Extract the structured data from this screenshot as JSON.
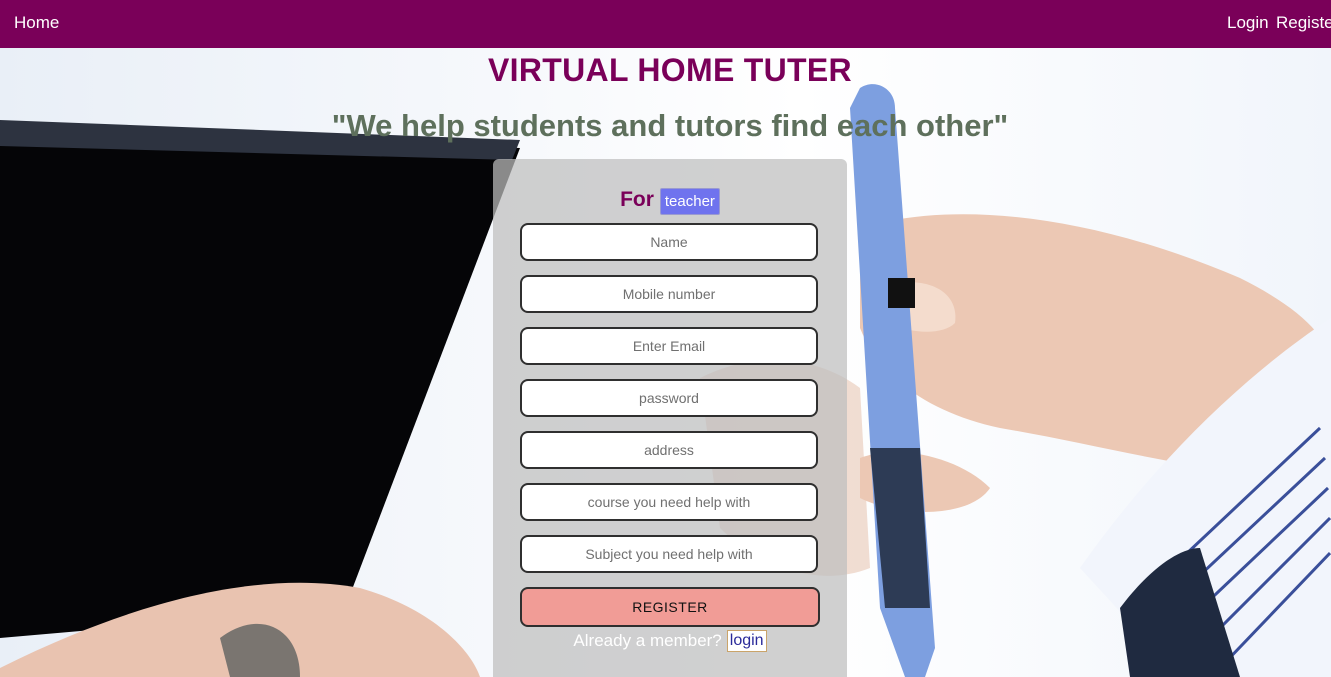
{
  "nav": {
    "home_label": "Home",
    "login_label": "Login",
    "register_label": "Register"
  },
  "header": {
    "title": "VIRTUAL HOME TUTER",
    "tagline": "\"We help students and tutors find each other\""
  },
  "form": {
    "for_label": "For",
    "role_label": "teacher",
    "fields": [
      {
        "placeholder": "Name"
      },
      {
        "placeholder": "Mobile number"
      },
      {
        "placeholder": "Enter Email"
      },
      {
        "placeholder": "password"
      },
      {
        "placeholder": "address"
      },
      {
        "placeholder": "course you need help with"
      },
      {
        "placeholder": "Subject you need help with"
      }
    ],
    "submit_label": "REGISTER",
    "member_prompt": "Already a member?",
    "login_link": "login"
  },
  "colors": {
    "nav_background": "#7a0059",
    "title_color": "#7a0059",
    "tagline_color": "#5e705c",
    "button_color": "#f19c96",
    "role_badge_color": "#6f73ee"
  }
}
